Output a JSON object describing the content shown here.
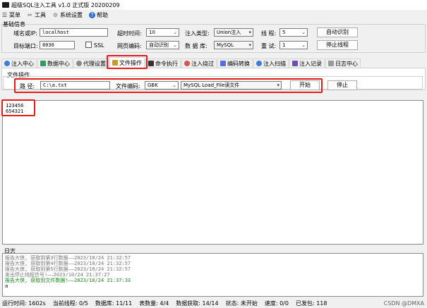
{
  "window": {
    "title": "超级SQL注入工具 v1.0 正式版 20200209"
  },
  "menu": [
    {
      "label": "菜单",
      "icon": "menu-icon"
    },
    {
      "label": "工具",
      "icon": "tools-icon"
    },
    {
      "label": "系统设置",
      "icon": "gear-icon"
    },
    {
      "label": "帮助",
      "icon": "help-icon"
    }
  ],
  "basic_info": {
    "group_title": "基础信息",
    "domain_label": "域名或IP:",
    "domain_value": "localhost",
    "timeout_label": "超时时间:",
    "timeout_value": "10",
    "inject_type_label": "注入类型:",
    "inject_type_value": "Union注入",
    "thread_label": "线 程:",
    "thread_value": "5",
    "auto_detect_button": "自动识别",
    "port_label": "目标端口:",
    "port_value": "8030",
    "ssl_label": "SSL",
    "encoding_label": "网页编码:",
    "encoding_value": "自动识别",
    "db_label": "数 据 库:",
    "db_value": "MySQL",
    "retry_label": "重 试:",
    "retry_value": "1",
    "stop_thread_button": "停止线程"
  },
  "tabs": [
    {
      "label": "注入中心",
      "color": "#3b7dd8"
    },
    {
      "label": "数据中心",
      "color": "#2f9e5b"
    },
    {
      "label": "代理设置",
      "color": "#8a8a8a"
    },
    {
      "label": "文件操作",
      "color": "#c79a2a",
      "active": true
    },
    {
      "label": "命令执行",
      "color": "#333333"
    },
    {
      "label": "注入绕过",
      "color": "#d9534f"
    },
    {
      "label": "编码转换",
      "color": "#5a6fd6"
    },
    {
      "label": "注入扫描",
      "color": "#3b7dd8"
    },
    {
      "label": "注入记录",
      "color": "#6b4fb5"
    },
    {
      "label": "日志中心",
      "color": "#999999"
    }
  ],
  "file_ops": {
    "group_title": "文件操作",
    "path_label": "路 径:",
    "path_value": "C:\\a.txt",
    "encoding_label": "文件编码:",
    "encoding_value": "GBK",
    "method_value": "MySQL Load_File读文件",
    "start_button": "开始",
    "stop_button": "停止"
  },
  "content": {
    "text": "123456\n654321"
  },
  "log": {
    "label": "日志",
    "lines": [
      {
        "text": "报告大侠, 获取到第3行数据——2023/10/24 21:32:57",
        "style": "gray"
      },
      {
        "text": "报告大侠, 获取到第4行数据——2023/10/24 21:32:57",
        "style": "gray"
      },
      {
        "text": "报告大侠, 获取到第5行数据——2023/10/24 21:32:57",
        "style": "gray"
      },
      {
        "text": "发出停止线程信号!——2023/10/24 21:37:27",
        "style": "gray"
      },
      {
        "text": "报告大侠, 获取到文件数据!——2023/10/24 21:37:33",
        "style": "green"
      },
      {
        "text": "a",
        "style": "dark"
      }
    ]
  },
  "status": {
    "run_time": "运行时间: 1602s",
    "threads": "当前线程: 0/5",
    "db_count": "数据库: 11/11",
    "table_count": "表数量: 4/4",
    "data_fetch": "数据获取: 14/14",
    "state": "状态: 未开始",
    "speed": "速度: 0/0",
    "sent": "已发包: 118",
    "watermark": "CSDN @DMXA"
  }
}
